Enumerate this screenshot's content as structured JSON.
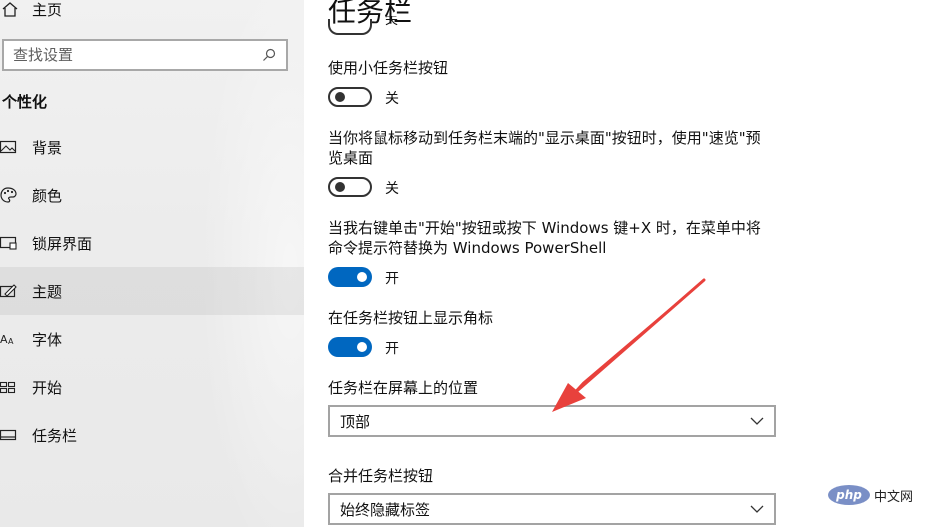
{
  "sidebar": {
    "home_label": "主页",
    "search": {
      "placeholder": "查找设置"
    },
    "section_heading": "个性化",
    "items": [
      {
        "label": "背景",
        "icon": "picture-icon"
      },
      {
        "label": "颜色",
        "icon": "palette-icon"
      },
      {
        "label": "锁屏界面",
        "icon": "lock-screen-icon"
      },
      {
        "label": "主题",
        "icon": "theme-brush-icon",
        "selected": true
      },
      {
        "label": "字体",
        "icon": "font-icon"
      },
      {
        "label": "开始",
        "icon": "start-icon"
      },
      {
        "label": "任务栏",
        "icon": "taskbar-icon"
      }
    ]
  },
  "main": {
    "title": "任务栏",
    "cut_toggle_state": "关",
    "settings": [
      {
        "label": "使用小任务栏按钮",
        "state": "关",
        "on": false
      },
      {
        "label": "当你将鼠标移动到任务栏末端的\"显示桌面\"按钮时，使用\"速览\"预览桌面",
        "state": "关",
        "on": false
      },
      {
        "label": "当我右键单击\"开始\"按钮或按下 Windows 键+X 时，在菜单中将命令提示符替换为 Windows PowerShell",
        "state": "开",
        "on": true
      },
      {
        "label": "在任务栏按钮上显示角标",
        "state": "开",
        "on": true
      }
    ],
    "position": {
      "label": "任务栏在屏幕上的位置",
      "value": "顶部"
    },
    "combine": {
      "label": "合并任务栏按钮",
      "value": "始终隐藏标签"
    }
  },
  "watermark": {
    "logo_text": "php",
    "text": "中文网"
  },
  "colors": {
    "accent": "#0067c0",
    "arrow": "#e8413c",
    "sidebar_bg": "#eeeeee"
  }
}
